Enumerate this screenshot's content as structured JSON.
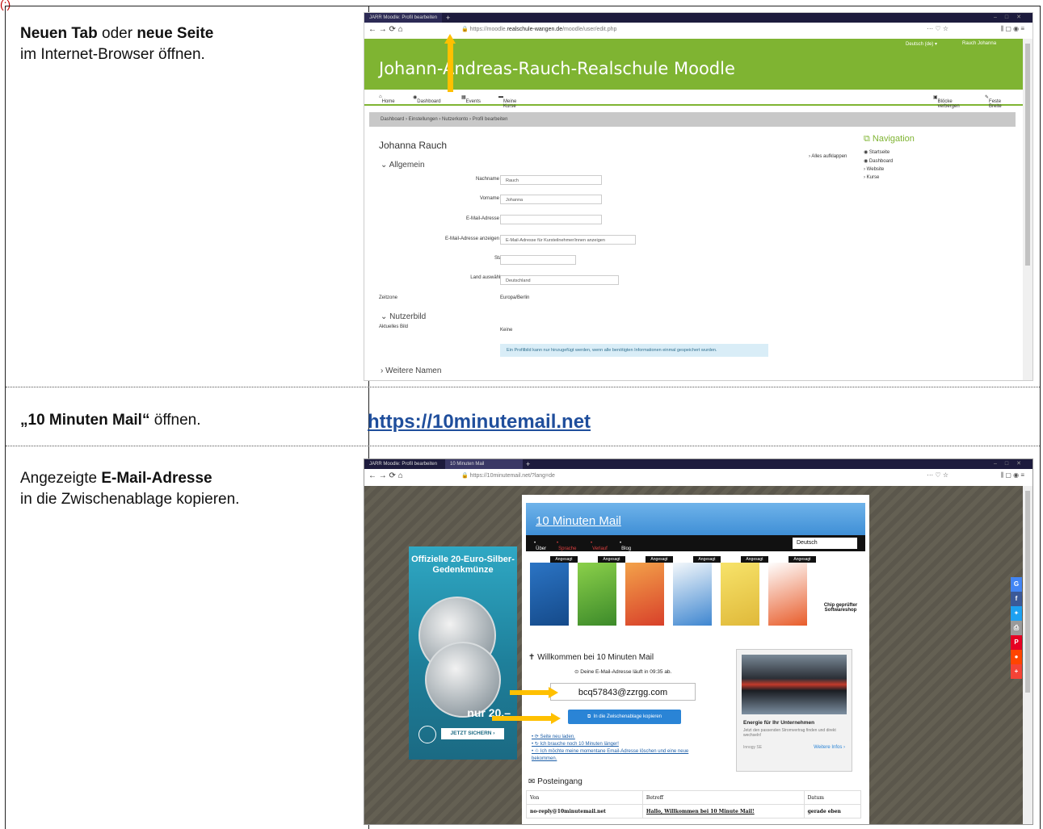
{
  "heading_marker": "(:)",
  "steps": [
    {
      "bold1": "Neuen Tab",
      "text1": " oder ",
      "bold2": "neue Seite",
      "line2": "im Internet-Browser öffnen."
    },
    {
      "bold": "„10 Minuten Mail“",
      "text": " öffnen.",
      "link": "https://10minutemail.net"
    },
    {
      "text1": "Angezeigte ",
      "bold": "E-Mail-Adresse",
      "line2": "in die Zwischenablage kopieren."
    }
  ],
  "moodle": {
    "tab_title": "JARR Moodle: Profil bearbeiten",
    "url_prefix": "https://moodle.",
    "url_domain": "realschule-wangen.de",
    "url_path": "/moodle/user/edit.php",
    "language": "Deutsch (de) ▾",
    "user": "Rauch Johanna",
    "site_title": "Johann-Andreas-Rauch-Realschule Moodle",
    "menu": [
      "Home",
      "Dashboard",
      "Events",
      "Meine Kurse"
    ],
    "menu_right": [
      "Blöcke verbergen",
      "Feste Breite"
    ],
    "breadcrumb": "Dashboard › Einstellungen › Nutzerkonto › Profil bearbeiten",
    "user_name": "Johanna Rauch",
    "expand_all": "Alles aufklappen",
    "section_general": "Allgemein",
    "fields": [
      {
        "label": "Nachname",
        "value": "Rauch"
      },
      {
        "label": "Vorname",
        "value": "Johanna"
      },
      {
        "label": "E-Mail-Adresse",
        "value": ""
      },
      {
        "label": "E-Mail-Adresse anzeigen",
        "value": "E-Mail-Adresse für Kursteilnehmer/innen anzeigen"
      },
      {
        "label": "Stadt",
        "value": ""
      },
      {
        "label": "Land auswählen",
        "value": "Deutschland"
      }
    ],
    "timezone_label": "Zeitzone",
    "timezone_value": "Europa/Berlin",
    "section_picture": "Nutzerbild",
    "current_picture_label": "Aktuelles Bild",
    "current_picture_value": "Keine",
    "picture_info": "Ein Profilbild kann nur hinzugefügt werden, wenn alle benötigten Informationen einmal gespeichert wurden.",
    "section_names": "Weitere Namen",
    "nav_title": "Navigation",
    "nav_items": [
      "Startseite",
      "Dashboard",
      "Website",
      "Kurse"
    ]
  },
  "tenmin": {
    "tab1": "JARR Moodle: Profil bearbeiten",
    "tab2": "10 Minuten Mail",
    "url": "https://10minutemail.net/?lang=de",
    "ad_title": "Offizielle 20-Euro-Silber-Gedenkmünze",
    "ad_price": "nur 20,–",
    "ad_cta": "JETZT SICHERN ›",
    "site_title": "10 Minuten Mail",
    "nav": [
      "Über",
      "Sprache",
      "Verlauf",
      "Blog"
    ],
    "lang_select": "Deutsch",
    "product_label": "Angesagt",
    "shop_name": "Chip geprüfter Softwareshop",
    "welcome": "Willkommen bei 10 Minuten Mail",
    "timer": "Deine E-Mail-Adresse läuft in 09:35 ab.",
    "email": "bcq57843@zzrgg.com",
    "copy_button": "In die Zwischenablage kopieren",
    "actions": [
      "Seite neu laden.",
      "Ich brauche noch 10 Minuten länger!",
      "Ich möchte meine momentane Email-Adresse löschen und eine neue bekommen."
    ],
    "ad2_title": "Energie für Ihr Unternehmen",
    "ad2_text": "Jetzt den passenden Stromvertrag finden und direkt wechseln!",
    "ad2_source": "Innogy SE",
    "ad2_more": "Weitere Infos ›",
    "inbox_title": "Posteingang",
    "inbox_headers": [
      "Von",
      "Betreff",
      "Datum"
    ],
    "inbox_row": [
      "no-reply@10minutemail.net",
      "Hallo, Willkommen bei 10 Minute Mail!",
      "gerade eben"
    ]
  },
  "colors": {
    "moodle_green": "#7fb432",
    "arrow": "#ffc000",
    "link": "#1f4e9c"
  }
}
